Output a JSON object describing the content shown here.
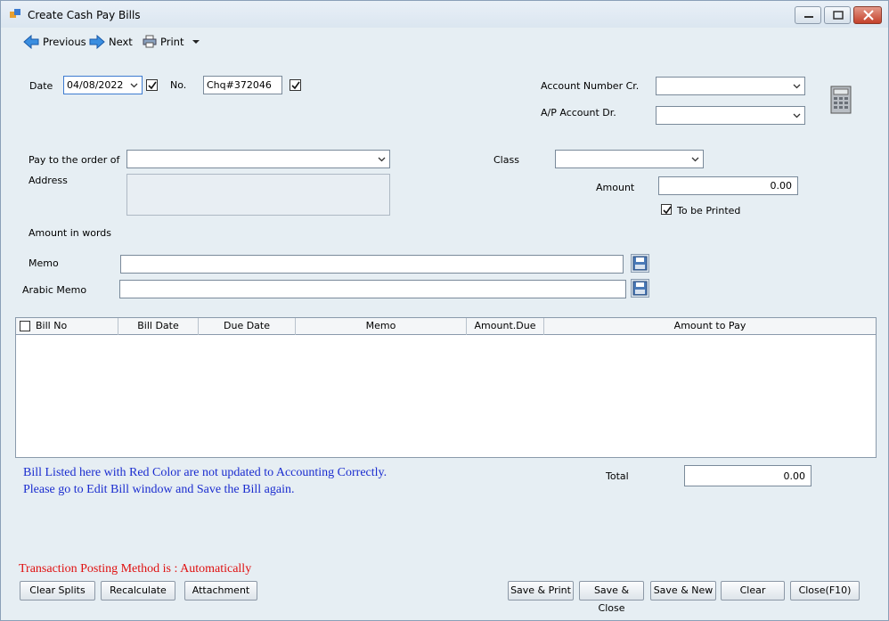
{
  "window": {
    "title": "Create Cash Pay Bills"
  },
  "toolbar": {
    "previous": "Previous",
    "next": "Next",
    "print": "Print"
  },
  "form": {
    "date_label": "Date",
    "date_value": "04/08/2022",
    "no_label": "No.",
    "no_value": "Chq#372046",
    "account_cr_label": "Account Number Cr.",
    "account_cr_value": "",
    "ap_account_label": "A/P Account Dr.",
    "ap_account_value": "",
    "pay_to_label": "Pay to the order of",
    "pay_to_value": "",
    "address_label": "Address",
    "class_label": "Class",
    "class_value": "",
    "amount_label": "Amount",
    "amount_value": "0.00",
    "to_be_printed_label": "To be Printed",
    "amount_words_label": "Amount in words",
    "memo_label": "Memo",
    "memo_value": "",
    "arabic_memo_label": "Arabic Memo",
    "arabic_memo_value": ""
  },
  "grid": {
    "columns": [
      "Bill No",
      "Bill Date",
      "Due Date",
      "Memo",
      "Amount.Due",
      "Amount to Pay"
    ],
    "rows": []
  },
  "notes": {
    "line1": "Bill Listed here with Red Color are not updated to Accounting Correctly.",
    "line2": "Please go to Edit Bill window and Save the Bill again.",
    "posting": "Transaction Posting Method is : Automatically"
  },
  "totals": {
    "label": "Total",
    "value": "0.00"
  },
  "buttons": {
    "clear_splits": "Clear Splits",
    "recalculate": "Recalculate",
    "attachment": "Attachment",
    "save_print": "Save & Print",
    "save_close": "Save & Close",
    "save_new": "Save & New",
    "clear": "Clear",
    "close": "Close(F10)"
  },
  "colors": {
    "note_blue": "#1a2ccf",
    "note_red": "#e01010",
    "background": "#e6eef3"
  }
}
